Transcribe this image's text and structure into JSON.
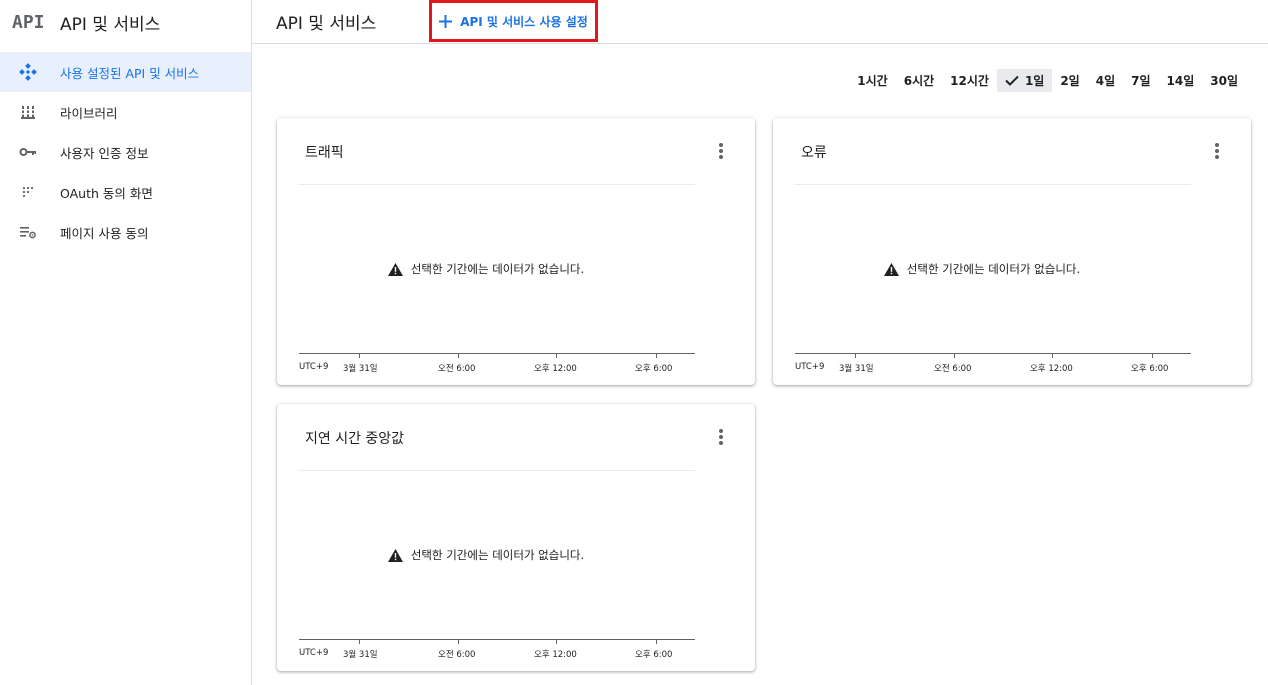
{
  "app": {
    "logo_text": "API",
    "title": "API 및 서비스"
  },
  "sidebar": {
    "items": [
      {
        "label": "사용 설정된 API 및 서비스",
        "icon": "api-diamond-icon",
        "active": true
      },
      {
        "label": "라이브러리",
        "icon": "library-icon",
        "active": false
      },
      {
        "label": "사용자 인증 정보",
        "icon": "key-icon",
        "active": false
      },
      {
        "label": "OAuth 동의 화면",
        "icon": "oauth-dots-icon",
        "active": false
      },
      {
        "label": "페이지 사용 동의",
        "icon": "settings-list-icon",
        "active": false
      }
    ]
  },
  "header": {
    "title": "API 및 서비스",
    "enable_button": "API 및 서비스 사용 설정",
    "enable_icon": "plus-icon"
  },
  "time_ranges": {
    "options": [
      "1시간",
      "6시간",
      "12시간",
      "1일",
      "2일",
      "4일",
      "7일",
      "14일",
      "30일"
    ],
    "selected": "1일"
  },
  "cards": [
    {
      "title": "트래픽",
      "no_data": "선택한 기간에는 데이터가 없습니다.",
      "axis": {
        "tz": "UTC+9",
        "labels": [
          "3월 31일",
          "오전 6:00",
          "오후 12:00",
          "오후 6:00"
        ]
      }
    },
    {
      "title": "오류",
      "no_data": "선택한 기간에는 데이터가 없습니다.",
      "axis": {
        "tz": "UTC+9",
        "labels": [
          "3월 31일",
          "오전 6:00",
          "오후 12:00",
          "오후 6:00"
        ]
      }
    },
    {
      "title": "지연 시간 중앙값",
      "no_data": "선택한 기간에는 데이터가 없습니다.",
      "axis": {
        "tz": "UTC+9",
        "labels": [
          "3월 31일",
          "오전 6:00",
          "오후 12:00",
          "오후 6:00"
        ]
      }
    }
  ],
  "colors": {
    "accent": "#1a73e8",
    "highlight_border": "#e3161b",
    "active_bg": "#e8f0fe"
  }
}
